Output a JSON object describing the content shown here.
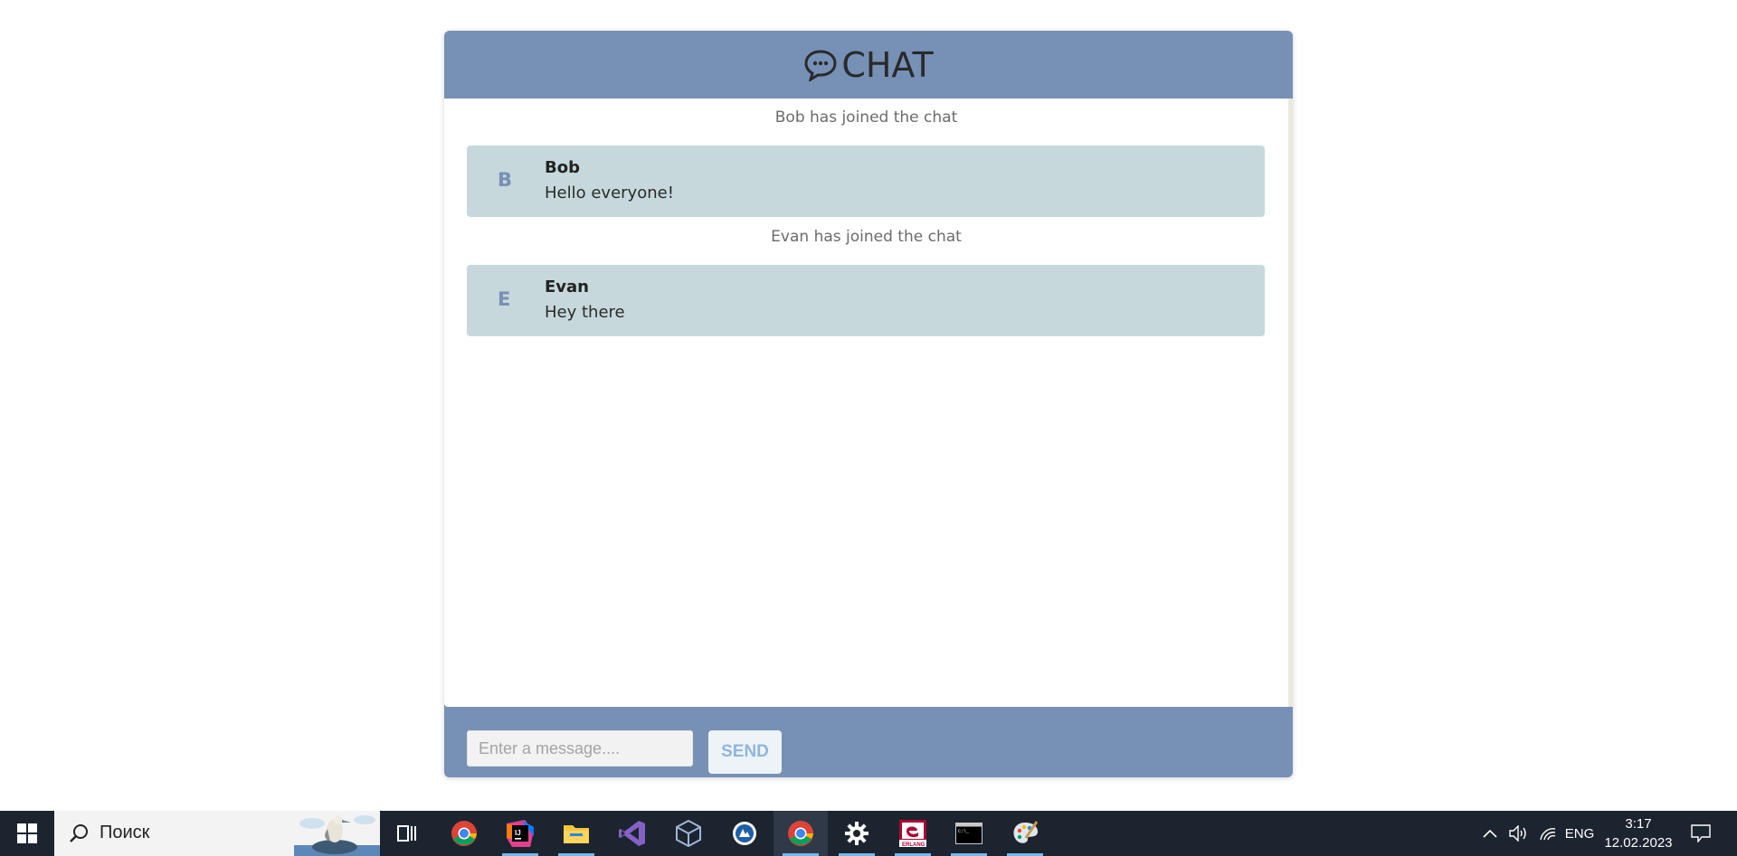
{
  "app": {
    "logo_text": "CHAT",
    "brand_color": "#7790b6",
    "message_bg": "#c6d8dc"
  },
  "messages": [
    {
      "system": "Bob has joined the chat"
    },
    {
      "avatar_letter": "B",
      "author": "Bob",
      "text": "Hello everyone!"
    },
    {
      "system": "Evan has joined the chat"
    },
    {
      "avatar_letter": "E",
      "author": "Evan",
      "text": "Hey there"
    }
  ],
  "composer": {
    "placeholder": "Enter a message....",
    "value": "",
    "send_label": "SEND"
  },
  "taskbar": {
    "search_label": "Поиск",
    "apps": [
      {
        "name": "task-view-icon"
      },
      {
        "name": "chrome-icon"
      },
      {
        "name": "intellij-idea-icon"
      },
      {
        "name": "file-explorer-icon"
      },
      {
        "name": "visual-studio-icon"
      },
      {
        "name": "virtualbox-icon"
      },
      {
        "name": "app-blue-icon"
      },
      {
        "name": "chrome-active-icon"
      },
      {
        "name": "settings-gear-icon"
      },
      {
        "name": "erlang-icon"
      },
      {
        "name": "terminal-icon"
      },
      {
        "name": "paint-icon"
      }
    ],
    "tray": {
      "language": "ENG",
      "time": "3:17",
      "date": "12.02.2023"
    }
  }
}
